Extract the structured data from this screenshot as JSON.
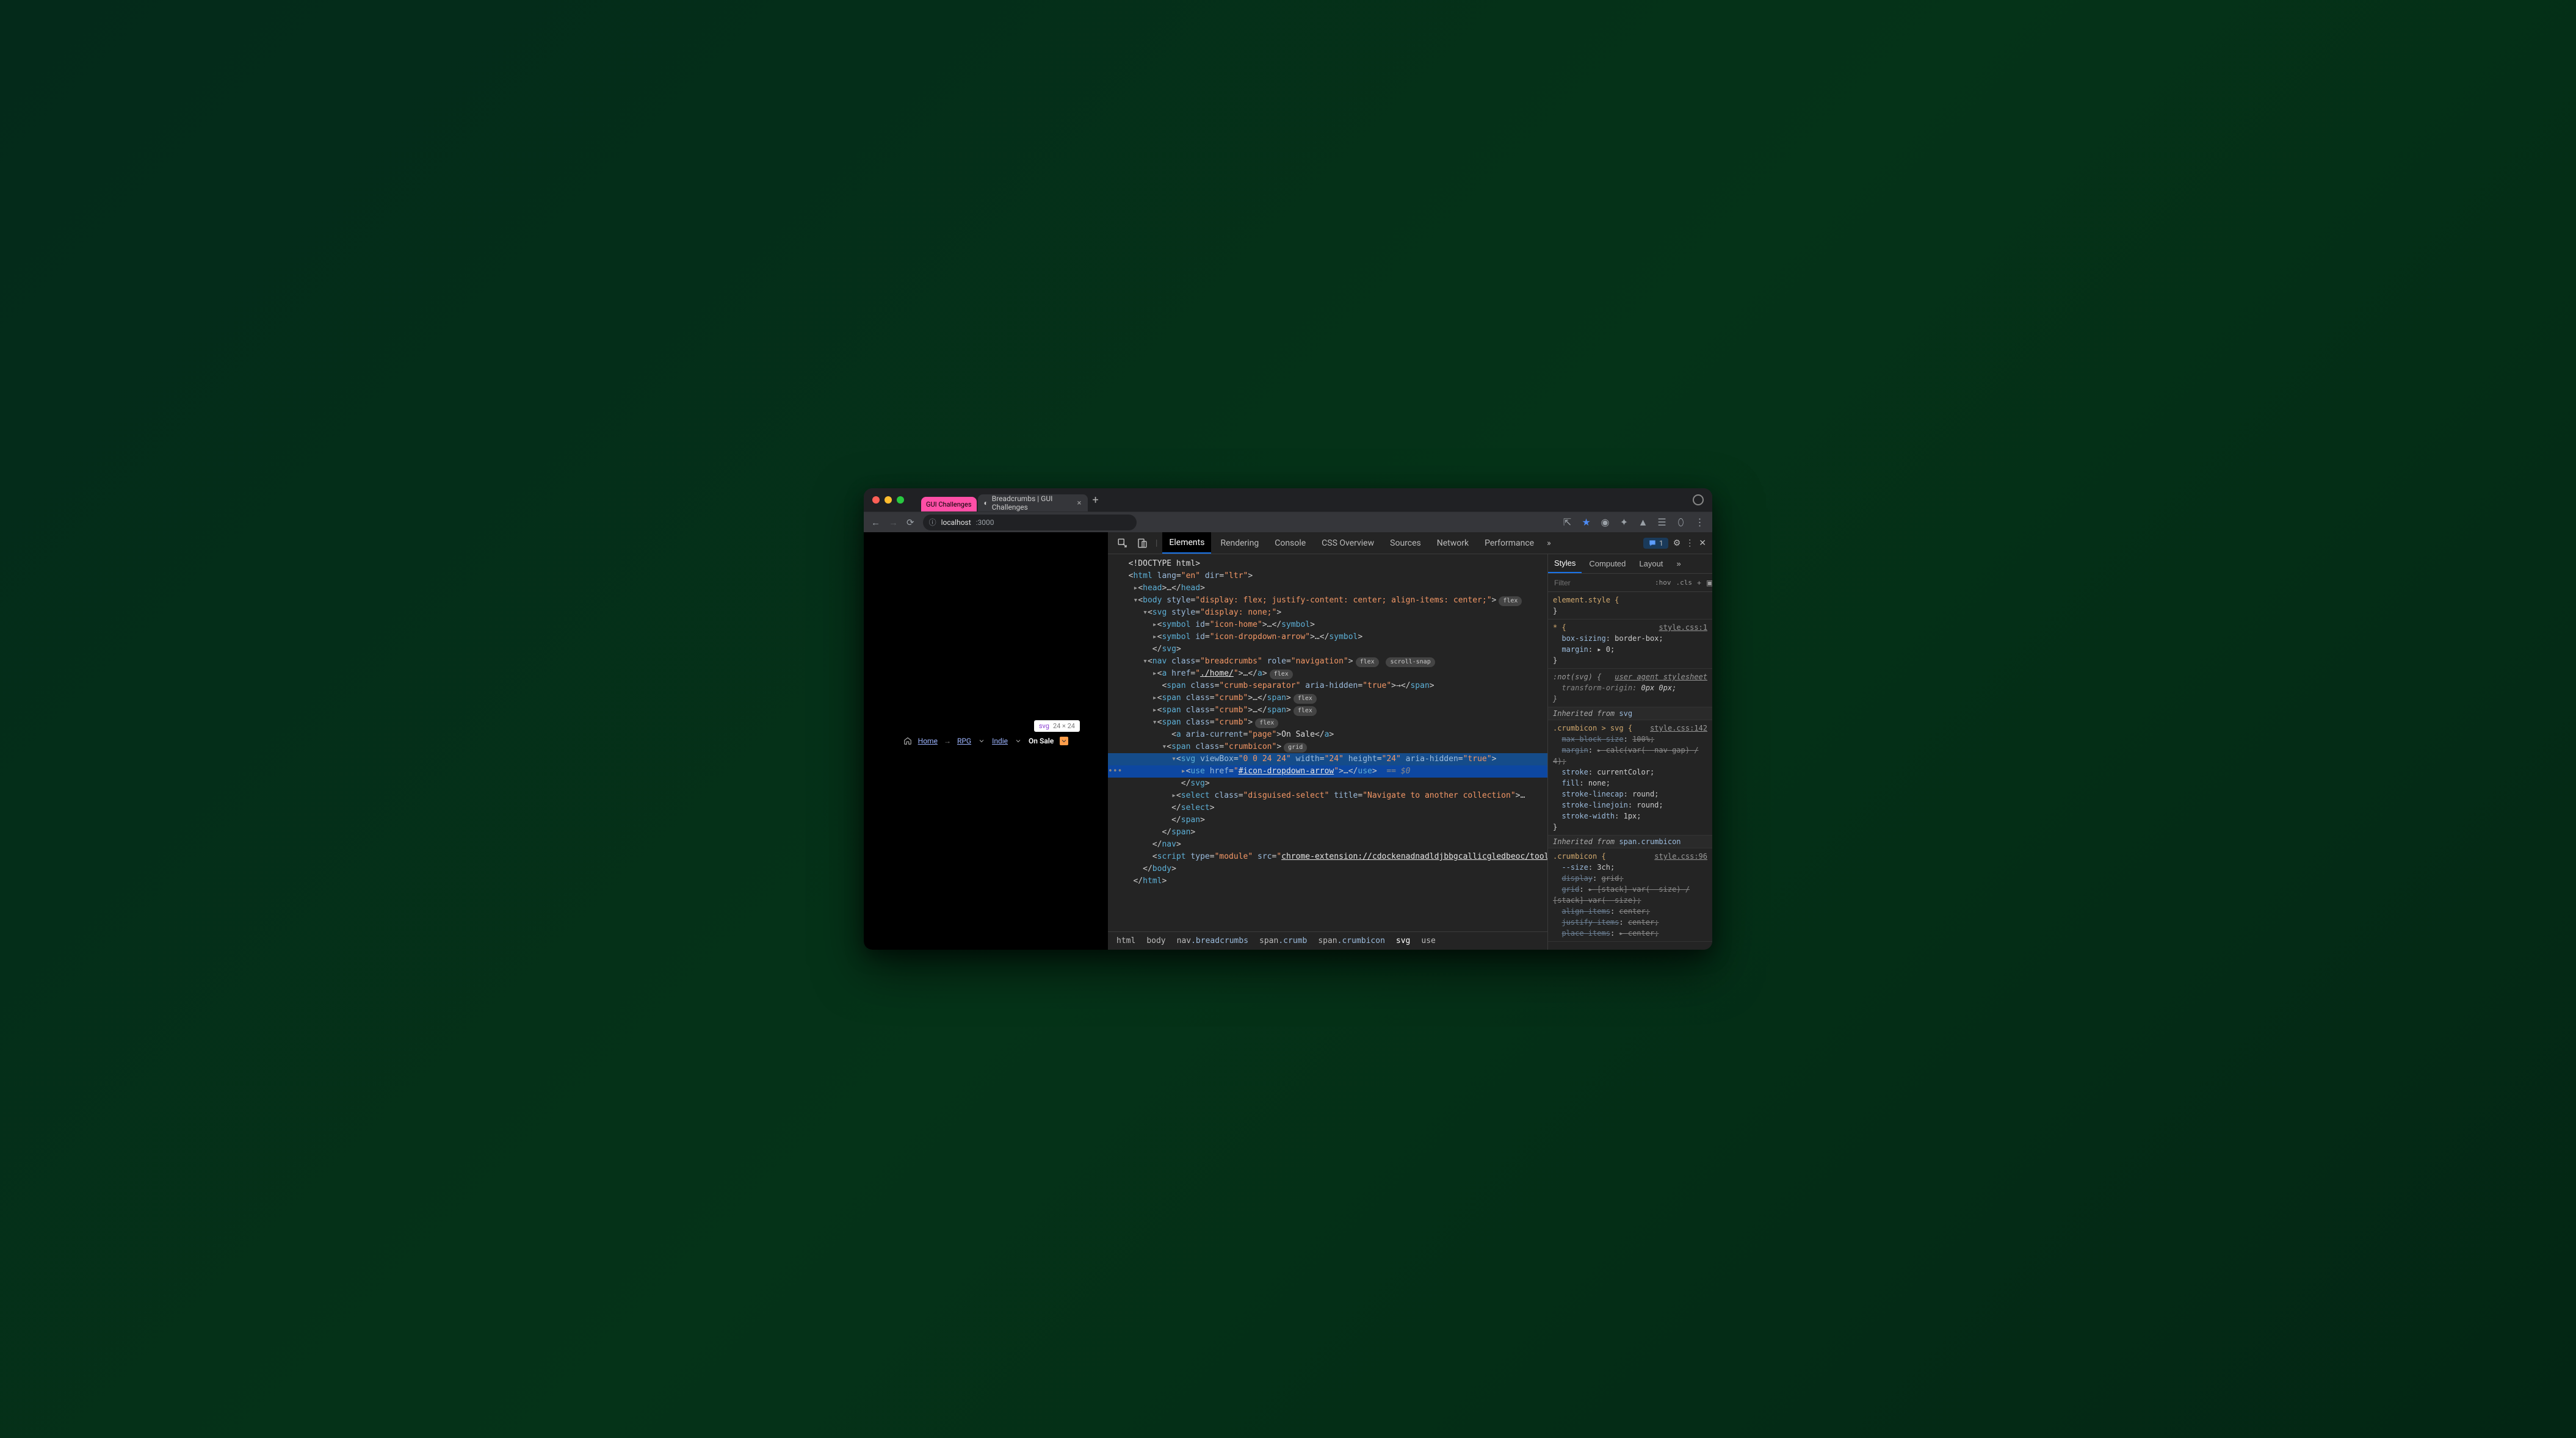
{
  "browser": {
    "tabs": [
      {
        "label": "GUI Challenges",
        "pinned": true
      },
      {
        "label": "Breadcrumbs | GUI Challenges",
        "active": true
      }
    ],
    "url_host": "localhost",
    "url_port": ":3000"
  },
  "tooltip": {
    "tag": "svg",
    "dims": "24 × 24"
  },
  "breadcrumbs": {
    "home": "Home",
    "rpg": "RPG",
    "indie": "Indie",
    "onsale": "On Sale"
  },
  "devtools": {
    "tabs": [
      "Elements",
      "Rendering",
      "Console",
      "CSS Overview",
      "Sources",
      "Network",
      "Performance"
    ],
    "active": "Elements",
    "issues": "1",
    "styles_tabs": [
      "Styles",
      "Computed",
      "Layout"
    ],
    "styles_active": "Styles",
    "filter_placeholder": "Filter",
    "hov": ":hov",
    "cls": ".cls",
    "path": [
      "html",
      "body",
      "nav.breadcrumbs",
      "span.crumb",
      "span.crumbicon",
      "svg",
      "use"
    ],
    "path_active": "svg",
    "dom": {
      "doctype": "<!DOCTYPE html>",
      "html_attrs": "lang=\"en\" dir=\"ltr\"",
      "body_style": "display: flex; justify-content: center; align-items: center;",
      "svg_style": "display: none;",
      "symbols": [
        "icon-home",
        "icon-dropdown-arrow"
      ],
      "nav_class": "breadcrumbs",
      "nav_role": "navigation",
      "home_href": "./home/",
      "sep_class": "crumb-separator",
      "sep_aria": "true",
      "crumb_class": "crumb",
      "current_page": "page",
      "current_text": "On Sale",
      "crumbicon_class": "crumbicon",
      "svg_viewbox": "0 0 24 24",
      "svg_w": "24",
      "svg_h": "24",
      "svg_aria": "true",
      "use_href": "#icon-dropdown-arrow",
      "eq_zero": "== $0",
      "select_class": "disguised-select",
      "select_title": "Navigate to another collection",
      "script_type": "module",
      "script_src": "chrome-extension://cdockenadnadldjbbgcallicgledbeoc/toolbar/bundle.min.js"
    },
    "styles": {
      "element_style": "element.style {",
      "rules": [
        {
          "sel": "* {",
          "src": "style.css:1",
          "decls": [
            {
              "p": "box-sizing",
              "v": "border-box;"
            },
            {
              "p": "margin",
              "v": "▸ 0;"
            }
          ]
        },
        {
          "sel": ":not(svg) {",
          "src": "user agent stylesheet",
          "ua": true,
          "decls": [
            {
              "p": "transform-origin",
              "v": "0px 0px;"
            }
          ]
        }
      ],
      "inh1": "Inherited from",
      "inh1_el": "svg",
      "rule_svg": {
        "sel": ".crumbicon > svg {",
        "src": "style.css:142",
        "decls": [
          {
            "p": "max-block-size",
            "v": "100%;",
            "strike": true
          },
          {
            "p": "margin",
            "v": "▸ calc(var(--nav-gap) / 4);",
            "strike": true
          },
          {
            "p": "stroke",
            "v": "currentColor;"
          },
          {
            "p": "fill",
            "v": "none;"
          },
          {
            "p": "stroke-linecap",
            "v": "round;"
          },
          {
            "p": "stroke-linejoin",
            "v": "round;"
          },
          {
            "p": "stroke-width",
            "v": "1px;"
          }
        ]
      },
      "inh2": "Inherited from",
      "inh2_el": "span.crumbicon",
      "rule_crumb": {
        "sel": ".crumbicon {",
        "src": "style.css:96",
        "decls": [
          {
            "p": "--size",
            "v": "3ch;"
          },
          {
            "p": "display",
            "v": "grid;",
            "strike": true
          },
          {
            "p": "grid",
            "v": "▸ [stack] var(--size) / [stack] var(--size);",
            "strike": true
          },
          {
            "p": "align-items",
            "v": "center;",
            "strike": true
          },
          {
            "p": "justify-items",
            "v": "center;",
            "strike": true
          },
          {
            "p": "place-items",
            "v": "▸ center;",
            "strike": true
          }
        ]
      }
    }
  }
}
